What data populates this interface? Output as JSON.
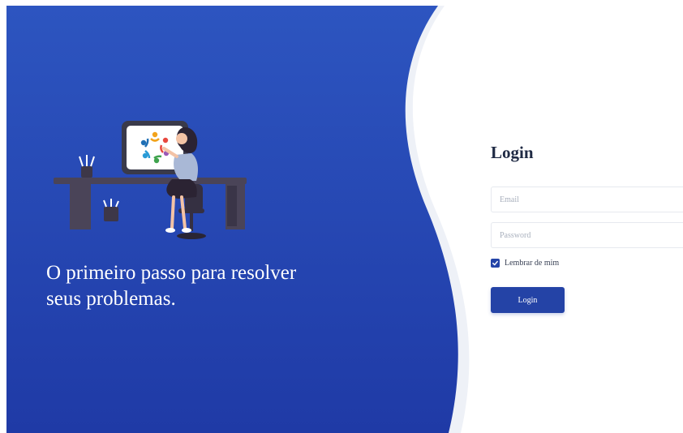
{
  "hero": {
    "tagline": "O primeiro passo para resolver seus problemas.",
    "colors": {
      "gradient_top": "#2d55c0",
      "gradient_bottom": "#1f3aa6"
    }
  },
  "login": {
    "title": "Login",
    "email_placeholder": "Email",
    "password_placeholder": "Password",
    "remember_label": "Lembrar de mim",
    "remember_checked": true,
    "button_label": "Login",
    "accent_color": "#2443a6"
  },
  "icons": [
    "illustration-person-at-desk",
    "check-icon"
  ]
}
